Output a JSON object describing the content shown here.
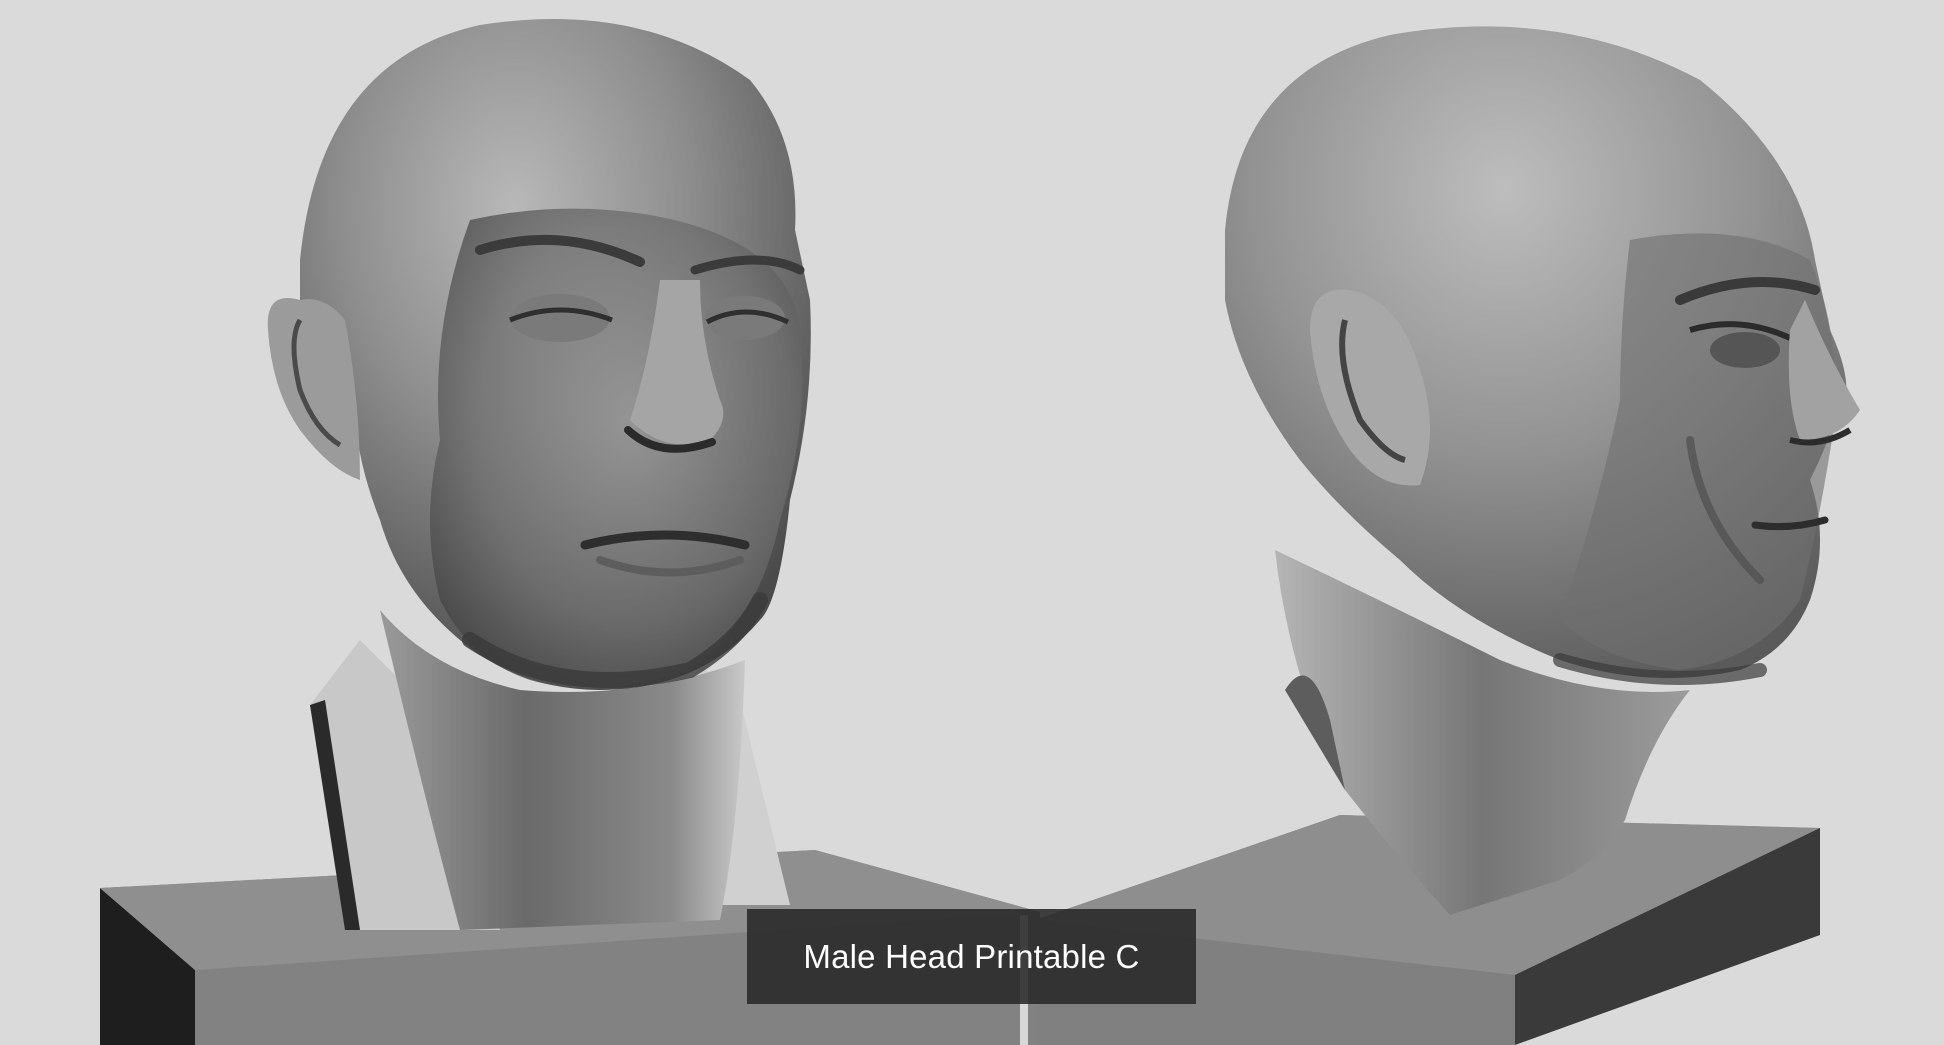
{
  "scene": {
    "background_color": "#dadada",
    "models": [
      {
        "name": "head-front-three-quarter-view"
      },
      {
        "name": "head-profile-view"
      }
    ]
  },
  "caption": {
    "text": "Male Head Printable C"
  }
}
